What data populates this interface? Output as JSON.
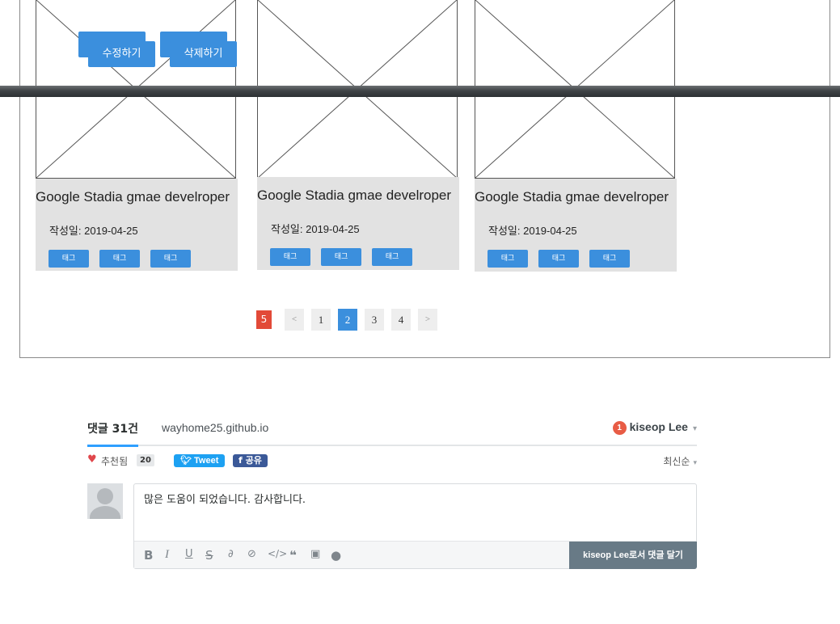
{
  "cards": [
    {
      "title": "Google Stadia gmae develroper",
      "date": "작성일: 2019-04-25",
      "tags": [
        "태그",
        "태그",
        "태그"
      ]
    },
    {
      "title": "Google Stadia gmae develroper",
      "date": "작성일: 2019-04-25",
      "tags": [
        "태그",
        "태그",
        "태그"
      ]
    },
    {
      "title": "Google Stadia gmae develroper",
      "date": "작성일: 2019-04-25",
      "tags": [
        "태그",
        "태그",
        "태그"
      ]
    }
  ],
  "overlay_buttons": {
    "edit": "수정하기",
    "delete": "삭제하기"
  },
  "pagination": {
    "count": "5",
    "prev": "<",
    "next": ">",
    "pages": [
      "1",
      "2",
      "3",
      "4"
    ],
    "active_page": "2"
  },
  "comments": {
    "count_label": "댓글 31건",
    "site": "wayhome25.github.io",
    "user": {
      "notification_count": "1",
      "name": "kiseop Lee"
    },
    "recommend_label": "추천됨",
    "recommend_count": "20",
    "tweet_label": "Tweet",
    "share_label": "공유",
    "sort_label": "최신순",
    "draft_text": "많은 도움이 되었습니다. 감사합니다.",
    "submit_label": "kiseop Lee로서 댓글 달기",
    "toolbar_icons": [
      "bold-icon",
      "italic-icon",
      "underline-icon",
      "strikethrough-icon",
      "link-icon",
      "spoiler-icon",
      "code-icon",
      "quote-icon",
      "image-icon",
      "gif-icon"
    ]
  },
  "colors": {
    "accent": "#3b8fdd",
    "count_badge": "#e24a38",
    "tweet": "#1da1f2",
    "facebook": "#3b5998",
    "submit": "#687a86"
  }
}
